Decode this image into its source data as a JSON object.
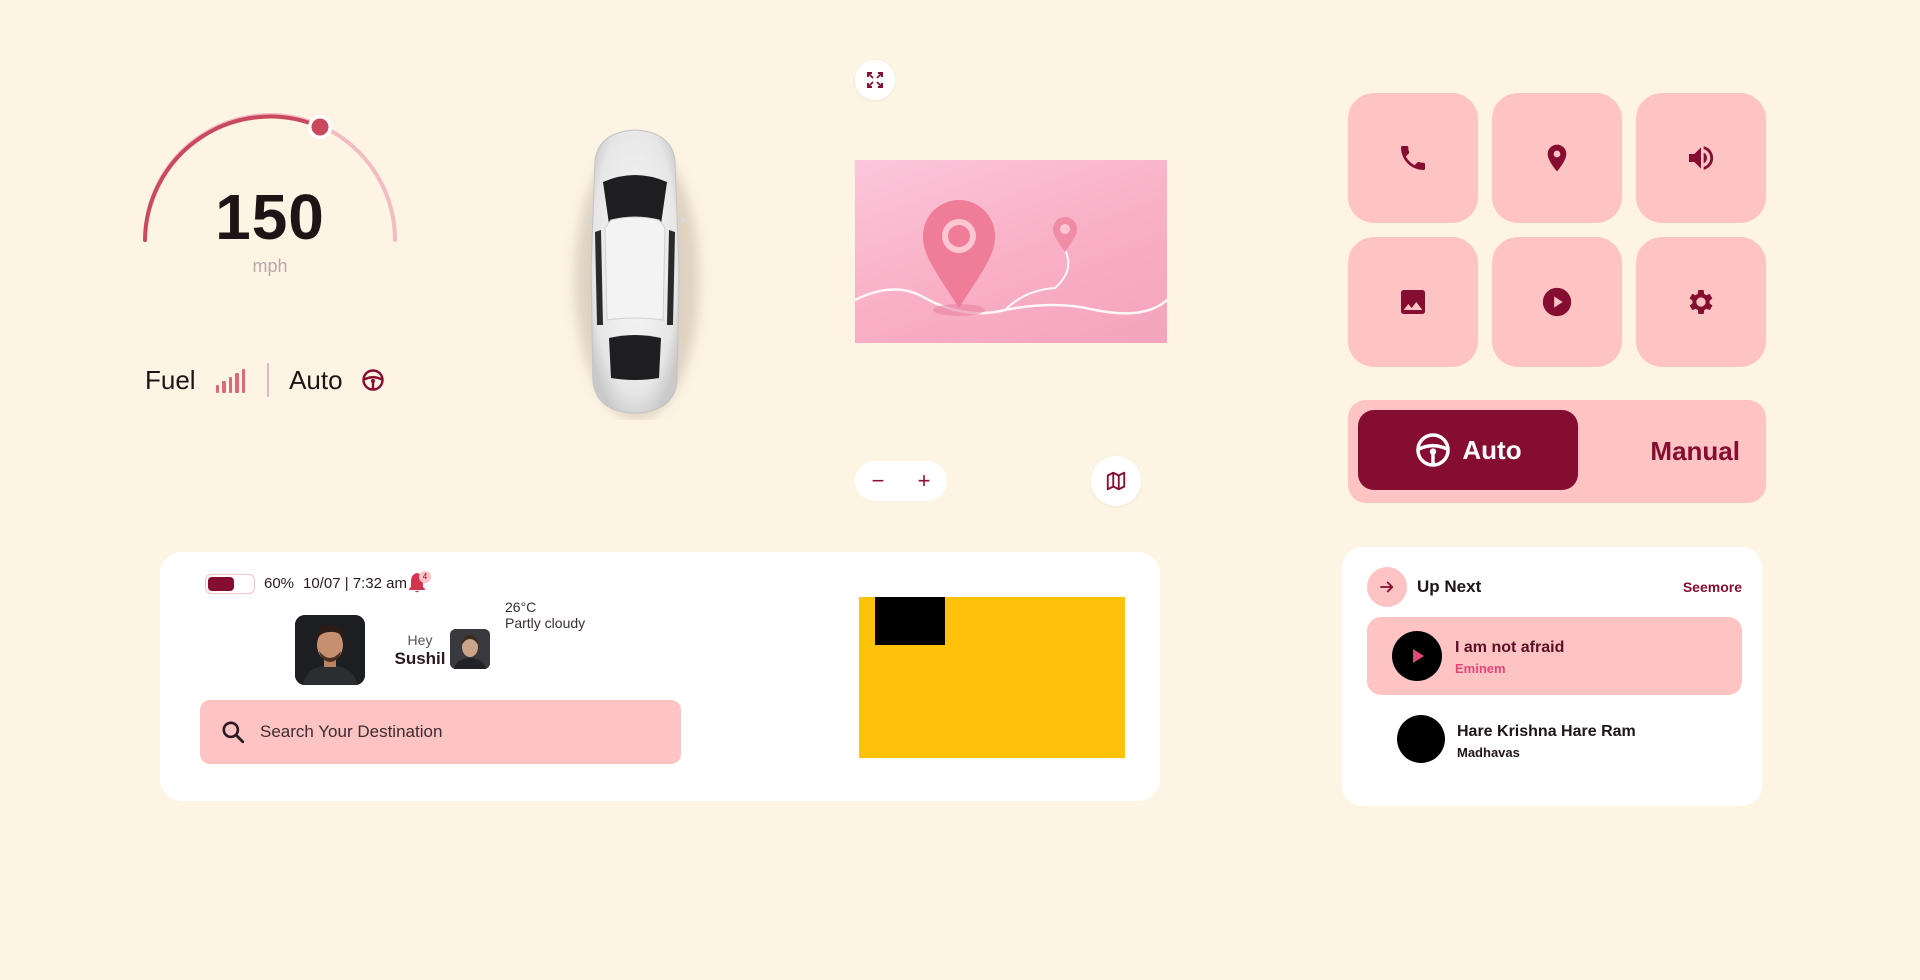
{
  "speedometer": {
    "value": "150",
    "unit": "mph",
    "level": 0.72
  },
  "status_row": {
    "fuel_label": "Fuel",
    "drive_label": "Auto"
  },
  "map": {
    "expand_icon": "expand-icon",
    "map_icon": "map-icon",
    "zoom_out": "−",
    "zoom_in": "+"
  },
  "quick_actions": [
    {
      "icon": "phone-icon"
    },
    {
      "icon": "location-pin-icon"
    },
    {
      "icon": "volume-icon"
    },
    {
      "icon": "image-icon"
    },
    {
      "icon": "play-icon"
    },
    {
      "icon": "settings-icon"
    }
  ],
  "drive_mode": {
    "active": "Auto",
    "inactive": "Manual"
  },
  "info": {
    "battery_percent": "60%",
    "battery_level": 0.6,
    "datetime": "10/07 | 7:32 am",
    "notifications": "4",
    "greeting": "Hey",
    "user_name": "Sushil",
    "temperature": "26°C",
    "condition": "Partly cloudy",
    "search_placeholder": "Search Your Destination"
  },
  "up_next": {
    "title": "Up Next",
    "see_more": "Seemore",
    "tracks": [
      {
        "name": "I am not afraid",
        "artist": "Eminem",
        "playing": true
      },
      {
        "name": "Hare Krishna Hare Ram",
        "artist": "Madhavas",
        "playing": false
      }
    ]
  },
  "colors": {
    "background": "#fdf4e3",
    "accent": "#840d31",
    "tile": "#fec3c3",
    "gauge": "#c94a5e"
  }
}
